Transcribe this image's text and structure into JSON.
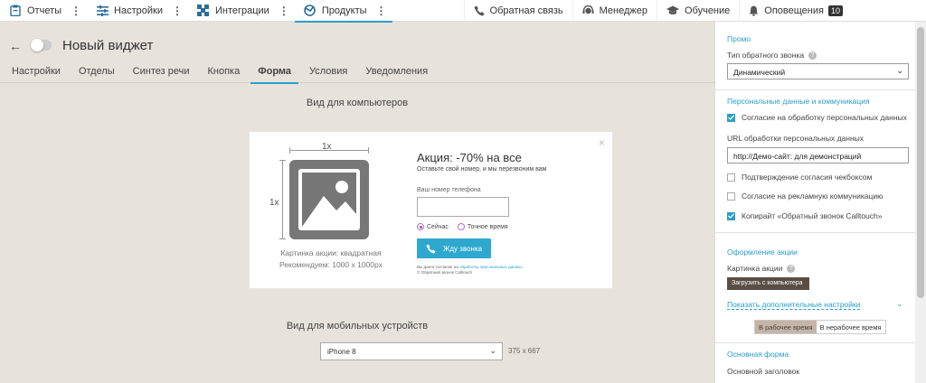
{
  "topnav": {
    "items": [
      {
        "label": "Отчеты",
        "icon": "clipboard-icon"
      },
      {
        "label": "Настройки",
        "icon": "sliders-icon"
      },
      {
        "label": "Интеграции",
        "icon": "integration-icon"
      },
      {
        "label": "Продукты",
        "icon": "products-icon",
        "active": true
      }
    ],
    "right": [
      {
        "label": "Обратная связь",
        "icon": "phone-icon"
      },
      {
        "label": "Менеджер",
        "icon": "headset-icon"
      },
      {
        "label": "Обучение",
        "icon": "graduation-cap-icon"
      },
      {
        "label": "Оповещения",
        "icon": "bell-icon",
        "badge": "10"
      }
    ],
    "accent": "#2a9fc8"
  },
  "header": {
    "title": "Новый виджет"
  },
  "tabs": [
    "Настройки",
    "Отделы",
    "Синтез речи",
    "Кнопка",
    "Форма",
    "Условия",
    "Уведомления"
  ],
  "active_tab": "Форма",
  "desktop": {
    "heading": "Вид для компьютеров",
    "widget": {
      "close": "×",
      "dim_top": "1x",
      "dim_left": "1x",
      "img_caption_1": "Картинка акции: квадратная",
      "img_caption_2": "Рекомендуем: 1000 x 1000px",
      "title": "Акция: -70% на все",
      "subtitle": "Оставьте свой номер, и мы перезвоним вам",
      "phone_label": "Ваш номер телефона",
      "radio_now": "Сейчас",
      "radio_exact": "Точное время",
      "call_button": "Жду звонка",
      "legal_1": "Вы даете согласие на ",
      "legal_link": "обработку персональных данных",
      "legal_2": "© Обратный звонок Calltouch"
    }
  },
  "mobile": {
    "heading": "Вид для мобильных устройств",
    "device": "iPhone 8",
    "size": "375 x 667"
  },
  "panel": {
    "promo_head": "Промо",
    "callback_type_label": "Тип обратного звонка",
    "callback_type_value": "Динамический",
    "personal_head": "Персональные данные и коммуникация",
    "chk_consent": "Согласие на обработку персональных данных",
    "url_label": "URL обработки персональных данных",
    "url_value": "http://Демо-сайт: для демонстраций",
    "chk_confirm": "Подтверждение согласия чекбоксом",
    "chk_ads": "Согласие на рекламную коммуникацию",
    "chk_copyright": "Копирайт «Обратный звонок Calltouch»",
    "promo_design_head": "Оформление акции",
    "promo_image_label": "Картинка акции",
    "upload_button": "Загрузить с компьютера",
    "more_link": "Показать дополнительные настройки",
    "seg_work": "В рабочее время",
    "seg_nonwork": "В нерабочее время",
    "main_form_head": "Основная форма",
    "main_title_label": "Основной заголовок"
  }
}
